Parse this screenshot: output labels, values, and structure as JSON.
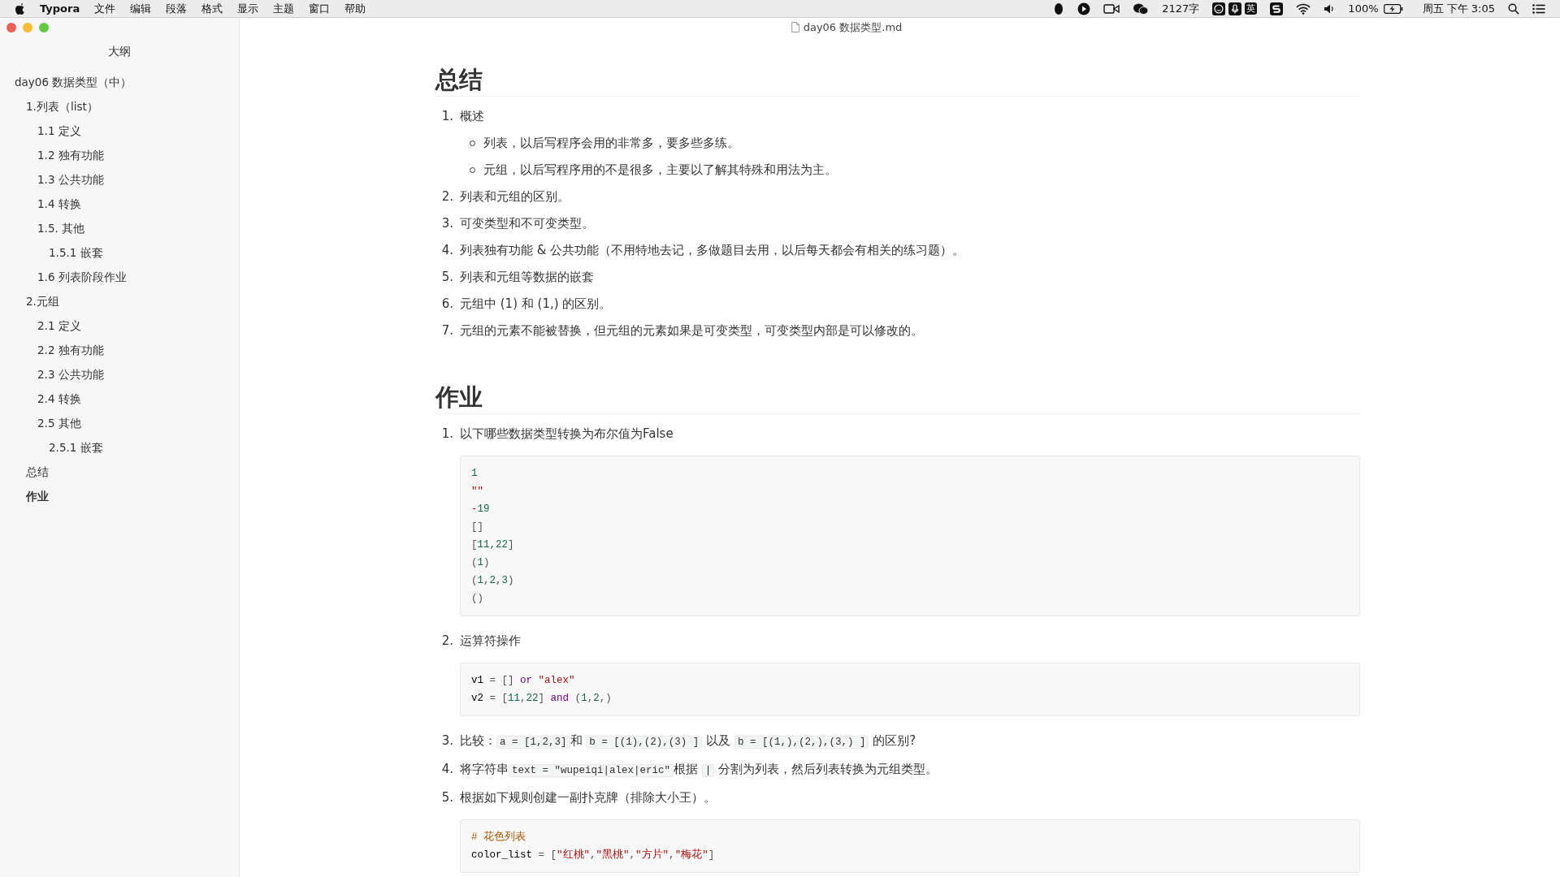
{
  "menubar": {
    "app": "Typora",
    "menus": [
      "文件",
      "编辑",
      "段落",
      "格式",
      "显示",
      "主题",
      "窗口",
      "帮助"
    ],
    "word_count": "2127字",
    "input_method": "英",
    "battery": "100%",
    "clock": "周五 下午 3:05"
  },
  "window": {
    "title": "day06 数据类型.md"
  },
  "sidebar": {
    "title": "大纲",
    "items": [
      {
        "label": "day06 数据类型（中）",
        "selected": false,
        "children": [
          {
            "label": "1.列表（list）",
            "selected": false,
            "children": [
              {
                "label": "1.1 定义",
                "selected": false
              },
              {
                "label": "1.2 独有功能",
                "selected": false
              },
              {
                "label": "1.3 公共功能",
                "selected": false
              },
              {
                "label": "1.4 转换",
                "selected": false
              },
              {
                "label": "1.5. 其他",
                "selected": false,
                "children": [
                  {
                    "label": "1.5.1 嵌套",
                    "selected": false
                  }
                ]
              },
              {
                "label": "1.6 列表阶段作业",
                "selected": false
              }
            ]
          },
          {
            "label": "2.元组",
            "selected": false,
            "children": [
              {
                "label": "2.1 定义",
                "selected": false
              },
              {
                "label": "2.2 独有功能",
                "selected": false
              },
              {
                "label": "2.3 公共功能",
                "selected": false
              },
              {
                "label": "2.4 转换",
                "selected": false
              },
              {
                "label": "2.5 其他",
                "selected": false,
                "children": [
                  {
                    "label": "2.5.1 嵌套",
                    "selected": false
                  }
                ]
              }
            ]
          },
          {
            "label": "总结",
            "selected": false
          },
          {
            "label": "作业",
            "selected": true
          }
        ]
      }
    ]
  },
  "document": [
    {
      "kind": "heading",
      "text": "总结"
    },
    {
      "kind": "list",
      "items": [
        {
          "number": "1.",
          "segments": [
            {
              "kind": "text",
              "text": "概述"
            }
          ],
          "bullets": [
            "列表，以后写程序会用的非常多，要多些多练。",
            "元组，以后写程序用的不是很多，主要以了解其特殊和用法为主。"
          ]
        },
        {
          "number": "2.",
          "segments": [
            {
              "kind": "text",
              "text": "列表和元组的区别。"
            }
          ]
        },
        {
          "number": "3.",
          "segments": [
            {
              "kind": "text",
              "text": "可变类型和不可变类型。"
            }
          ]
        },
        {
          "number": "4.",
          "segments": [
            {
              "kind": "text",
              "text": "列表独有功能 & 公共功能（不用特地去记，多做题目去用，以后每天都会有相关的练习题）。"
            }
          ]
        },
        {
          "number": "5.",
          "segments": [
            {
              "kind": "text",
              "text": "列表和元组等数据的嵌套"
            }
          ]
        },
        {
          "number": "6.",
          "segments": [
            {
              "kind": "text",
              "text": "元组中 (1) 和 (1,) 的区别。"
            }
          ]
        },
        {
          "number": "7.",
          "segments": [
            {
              "kind": "text",
              "text": "元组的元素不能被替换，但元组的元素如果是可变类型，可变类型内部是可以修改的。"
            }
          ]
        }
      ]
    },
    {
      "kind": "heading",
      "text": "作业"
    },
    {
      "kind": "list",
      "items": [
        {
          "number": "1.",
          "segments": [
            {
              "kind": "text",
              "text": "以下哪些数据类型转换为布尔值为False"
            }
          ],
          "code": [
            [
              {
                "kind": "num",
                "text": "1"
              }
            ],
            [
              {
                "kind": "str",
                "text": "\"\""
              }
            ],
            [
              {
                "kind": "neg",
                "text": "-"
              },
              {
                "kind": "num",
                "text": "19"
              }
            ],
            [
              {
                "kind": "punct",
                "text": "[]"
              }
            ],
            [
              {
                "kind": "punct",
                "text": "["
              },
              {
                "kind": "num",
                "text": "11"
              },
              {
                "kind": "punct",
                "text": ","
              },
              {
                "kind": "num",
                "text": "22"
              },
              {
                "kind": "punct",
                "text": "]"
              }
            ],
            [
              {
                "kind": "punct",
                "text": "("
              },
              {
                "kind": "num",
                "text": "1"
              },
              {
                "kind": "punct",
                "text": ")"
              }
            ],
            [
              {
                "kind": "punct",
                "text": "("
              },
              {
                "kind": "num",
                "text": "1"
              },
              {
                "kind": "punct",
                "text": ","
              },
              {
                "kind": "num",
                "text": "2"
              },
              {
                "kind": "punct",
                "text": ","
              },
              {
                "kind": "num",
                "text": "3"
              },
              {
                "kind": "punct",
                "text": ")"
              }
            ],
            [
              {
                "kind": "punct",
                "text": "()"
              }
            ]
          ]
        },
        {
          "number": "2.",
          "segments": [
            {
              "kind": "text",
              "text": "运算符操作"
            }
          ],
          "code": [
            [
              {
                "kind": "plain",
                "text": "v1 "
              },
              {
                "kind": "punct",
                "text": "= [] "
              },
              {
                "kind": "kw",
                "text": "or"
              },
              {
                "kind": "str",
                "text": " \"alex\""
              }
            ],
            [
              {
                "kind": "plain",
                "text": "v2 "
              },
              {
                "kind": "punct",
                "text": "= ["
              },
              {
                "kind": "num",
                "text": "11"
              },
              {
                "kind": "punct",
                "text": ","
              },
              {
                "kind": "num",
                "text": "22"
              },
              {
                "kind": "punct",
                "text": "] "
              },
              {
                "kind": "kw",
                "text": "and"
              },
              {
                "kind": "punct",
                "text": " ("
              },
              {
                "kind": "num",
                "text": "1"
              },
              {
                "kind": "punct",
                "text": ","
              },
              {
                "kind": "num",
                "text": "2"
              },
              {
                "kind": "punct",
                "text": ",)"
              }
            ]
          ]
        },
        {
          "number": "3.",
          "segments": [
            {
              "kind": "text",
              "text": "比较："
            },
            {
              "kind": "code",
              "text": "a = [1,2,3]"
            },
            {
              "kind": "text",
              "text": "和 "
            },
            {
              "kind": "code",
              "text": "b = [(1),(2),(3) ]"
            },
            {
              "kind": "text",
              "text": " 以及 "
            },
            {
              "kind": "code",
              "text": "b = [(1,),(2,),(3,) ]"
            },
            {
              "kind": "text",
              "text": " 的区别?"
            }
          ]
        },
        {
          "number": "4.",
          "segments": [
            {
              "kind": "text",
              "text": "将字符串"
            },
            {
              "kind": "code",
              "text": "text = \"wupeiqi|alex|eric\""
            },
            {
              "kind": "text",
              "text": "根据 "
            },
            {
              "kind": "code",
              "text": "|"
            },
            {
              "kind": "text",
              "text": " 分割为列表，然后列表转换为元组类型。"
            }
          ]
        },
        {
          "number": "5.",
          "segments": [
            {
              "kind": "text",
              "text": "根据如下规则创建一副扑克牌（排除大小王）。"
            }
          ],
          "code": [
            [
              {
                "kind": "comment",
                "text": "# 花色列表"
              }
            ],
            [
              {
                "kind": "plain",
                "text": "color_list "
              },
              {
                "kind": "punct",
                "text": "= ["
              },
              {
                "kind": "str",
                "text": "\"红桃\""
              },
              {
                "kind": "punct",
                "text": ","
              },
              {
                "kind": "str",
                "text": "\"黑桃\""
              },
              {
                "kind": "punct",
                "text": ","
              },
              {
                "kind": "str",
                "text": "\"方片\""
              },
              {
                "kind": "punct",
                "text": ","
              },
              {
                "kind": "str",
                "text": "\"梅花\""
              },
              {
                "kind": "punct",
                "text": "]"
              }
            ]
          ]
        }
      ]
    }
  ]
}
